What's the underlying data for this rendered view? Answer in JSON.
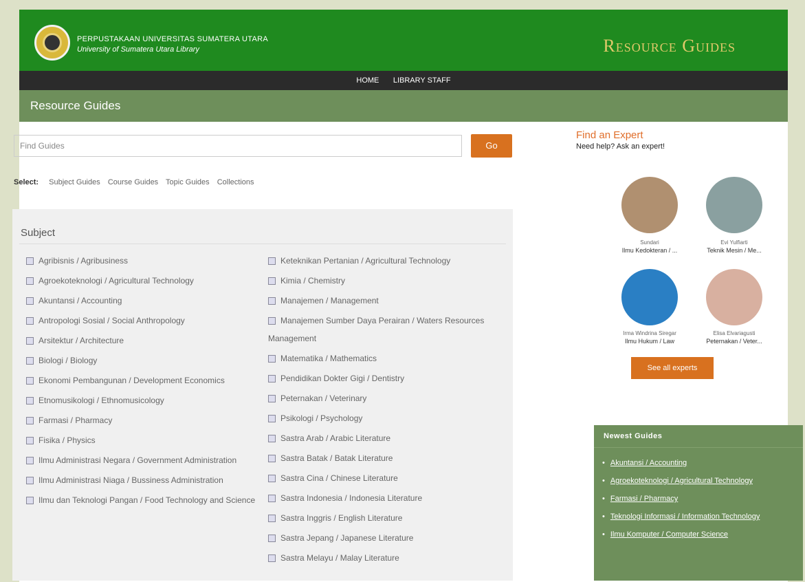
{
  "header": {
    "brand_line1": "PERPUSTAKAAN UNIVERSITAS SUMATERA UTARA",
    "brand_line2": "University of Sumatera Utara Library",
    "title": "Resource Guides"
  },
  "nav": {
    "home": "HOME",
    "staff": "LIBRARY STAFF"
  },
  "page_title": "Resource Guides",
  "search": {
    "placeholder": "Find Guides",
    "button": "Go"
  },
  "select": {
    "label": "Select:",
    "options": [
      "Subject Guides",
      "Course Guides",
      "Topic Guides",
      "Collections"
    ]
  },
  "subject": {
    "title": "Subject",
    "col1": [
      "Agribisnis / Agribusiness",
      "Agroekoteknologi / Agricultural Technology",
      "Akuntansi / Accounting",
      "Antropologi Sosial / Social Anthropology",
      "Arsitektur / Architecture",
      "Biologi / Biology",
      "Ekonomi Pembangunan / Development Economics",
      "Etnomusikologi / Ethnomusicology",
      "Farmasi / Pharmacy",
      "Fisika / Physics",
      "Ilmu Administrasi Negara / Government Administration",
      "Ilmu Administrasi Niaga / Bussiness Administration",
      "Ilmu dan Teknologi Pangan / Food Technology and Science"
    ],
    "col2": [
      "Keteknikan Pertanian / Agricultural Technology",
      "Kimia / Chemistry",
      "Manajemen / Management",
      "Manajemen Sumber Daya Perairan / Waters Resources Management",
      "Matematika / Mathematics",
      "Pendidikan Dokter Gigi / Dentistry",
      "Peternakan / Veterinary",
      "Psikologi / Psychology",
      "Sastra Arab / Arabic Literature",
      "Sastra Batak / Batak Literature",
      "Sastra Cina / Chinese Literature",
      "Sastra Indonesia / Indonesia Literature",
      "Sastra Inggris / English Literature",
      "Sastra Jepang / Japanese Literature",
      "Sastra Melayu / Malay Literature"
    ]
  },
  "experts": {
    "title": "Find an Expert",
    "subtitle": "Need help? Ask an expert!",
    "people": [
      {
        "name": "Sundari",
        "role": "Ilmu Kedokteran / ..."
      },
      {
        "name": "Evi Yulfiarti",
        "role": "Teknik Mesin / Me..."
      },
      {
        "name": "Irma Windrina Siregar",
        "role": "Ilmu Hukum / Law"
      },
      {
        "name": "Elisa Elvariagusti",
        "role": "Peternakan / Veter..."
      }
    ],
    "see_all": "See all experts"
  },
  "newest": {
    "title": "Newest Guides",
    "items": [
      "Akuntansi / Accounting",
      "Agroekoteknologi / Agricultural Technology",
      "Farmasi / Pharmacy",
      "Teknologi Informasi / Information Technology",
      "Ilmu Komputer / Computer Science"
    ]
  }
}
